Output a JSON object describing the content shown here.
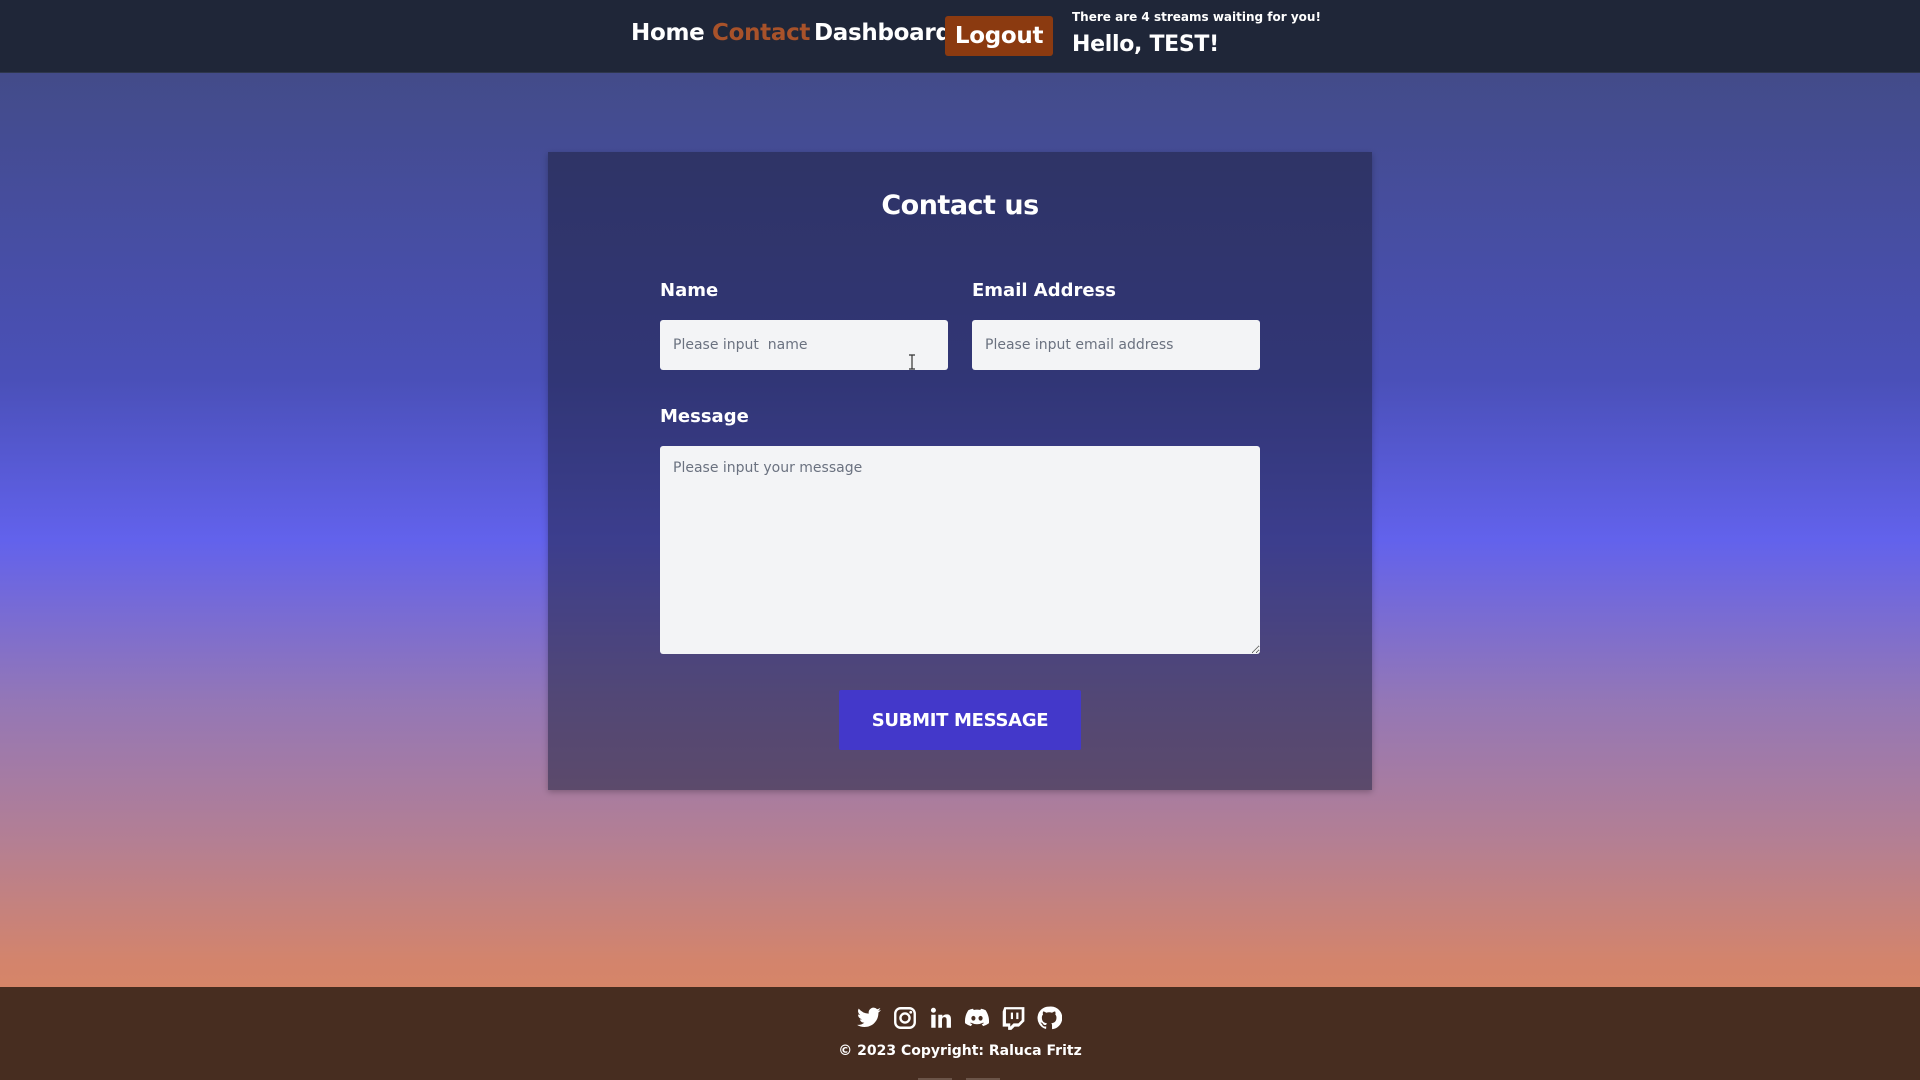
{
  "nav": {
    "home": "Home",
    "contact": "Contact",
    "dashboard": "Dashboard",
    "logout": "Logout",
    "streams_note": "There are 4 streams waiting for you!",
    "greeting": "Hello, TEST!"
  },
  "form": {
    "title": "Contact us",
    "name_label": "Name",
    "name_placeholder": "Please input  name",
    "email_label": "Email Address",
    "email_placeholder": "Please input email address",
    "message_label": "Message",
    "message_placeholder": "Please input your message",
    "submit": "SUBMIT MESSAGE"
  },
  "footer": {
    "social_icons": [
      "twitter-icon",
      "instagram-icon",
      "linkedin-icon",
      "discord-icon",
      "twitch-icon",
      "github-icon"
    ],
    "copyright": "© 2023 Copyright: Raluca Fritz"
  },
  "colors": {
    "nav_bg": "#1f2638",
    "active_link": "#a8522a",
    "logout_bg": "#8b3a10",
    "submit_bg": "#4338ca",
    "footer_bg": "#472d20"
  }
}
